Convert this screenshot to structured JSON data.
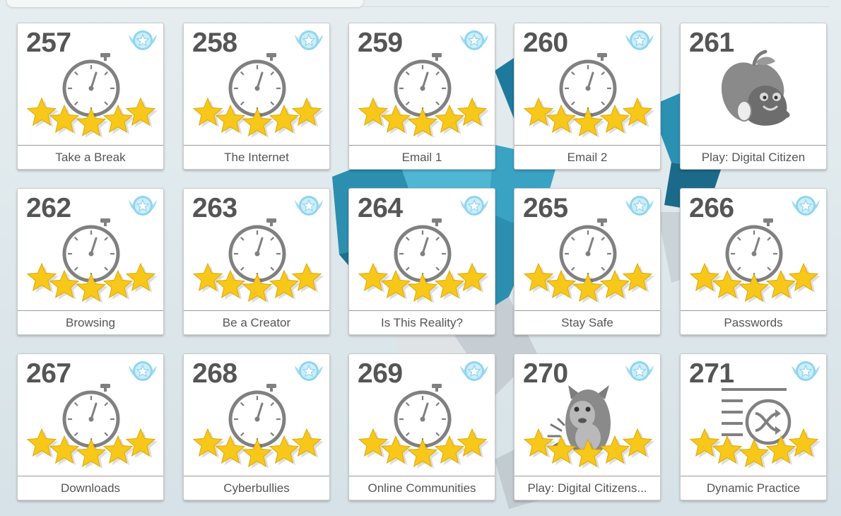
{
  "colors": {
    "star": "#f7c81a",
    "badge": "#7fd2ef",
    "icon_gray": "#808080",
    "number_text": "#555555"
  },
  "tiles": [
    {
      "number": "257",
      "title": "Take a Break",
      "icon": "stopwatch-icon",
      "stars_earned": 5,
      "stars_total": 5,
      "badge": "star-badge-icon"
    },
    {
      "number": "258",
      "title": "The Internet",
      "icon": "stopwatch-icon",
      "stars_earned": 5,
      "stars_total": 5,
      "badge": "star-badge-icon"
    },
    {
      "number": "259",
      "title": "Email 1",
      "icon": "stopwatch-icon",
      "stars_earned": 5,
      "stars_total": 5,
      "badge": "star-badge-icon"
    },
    {
      "number": "260",
      "title": "Email 2",
      "icon": "stopwatch-icon",
      "stars_earned": 5,
      "stars_total": 5,
      "badge": "star-badge-icon"
    },
    {
      "number": "261",
      "title": "Play: Digital Citizen",
      "icon": "apple-mascot-icon",
      "stars_earned": 0,
      "stars_total": 0,
      "badge": ""
    },
    {
      "number": "262",
      "title": "Browsing",
      "icon": "stopwatch-icon",
      "stars_earned": 5,
      "stars_total": 5,
      "badge": "star-badge-icon"
    },
    {
      "number": "263",
      "title": "Be a Creator",
      "icon": "stopwatch-icon",
      "stars_earned": 5,
      "stars_total": 5,
      "badge": "star-badge-icon"
    },
    {
      "number": "264",
      "title": "Is This Reality?",
      "icon": "stopwatch-icon",
      "stars_earned": 5,
      "stars_total": 5,
      "badge": "star-badge-icon"
    },
    {
      "number": "265",
      "title": "Stay Safe",
      "icon": "stopwatch-icon",
      "stars_earned": 5,
      "stars_total": 5,
      "badge": "star-badge-icon"
    },
    {
      "number": "266",
      "title": "Passwords",
      "icon": "stopwatch-icon",
      "stars_earned": 5,
      "stars_total": 5,
      "badge": "star-badge-icon"
    },
    {
      "number": "267",
      "title": "Downloads",
      "icon": "stopwatch-icon",
      "stars_earned": 5,
      "stars_total": 5,
      "badge": "star-badge-icon"
    },
    {
      "number": "268",
      "title": "Cyberbullies",
      "icon": "stopwatch-icon",
      "stars_earned": 5,
      "stars_total": 5,
      "badge": "star-badge-icon"
    },
    {
      "number": "269",
      "title": "Online Communities",
      "icon": "stopwatch-icon",
      "stars_earned": 5,
      "stars_total": 5,
      "badge": "star-badge-icon"
    },
    {
      "number": "270",
      "title": "Play: Digital Citizens...",
      "icon": "monster-mascot-icon",
      "stars_earned": 5,
      "stars_total": 5,
      "badge": "star-badge-icon"
    },
    {
      "number": "271",
      "title": "Dynamic Practice",
      "icon": "shuffle-practice-icon",
      "stars_earned": 5,
      "stars_total": 5,
      "badge": "star-badge-icon"
    }
  ]
}
